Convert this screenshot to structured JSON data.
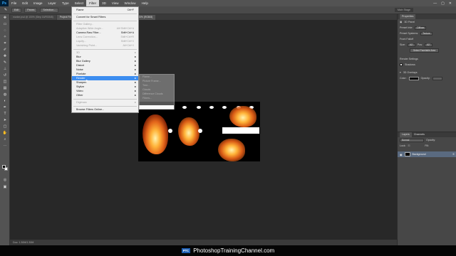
{
  "app": {
    "logo": "Ps"
  },
  "menubar": {
    "items": [
      "File",
      "Edit",
      "Image",
      "Layer",
      "Type",
      "Select",
      "Filter",
      "3D",
      "View",
      "Window",
      "Help"
    ],
    "window_controls": [
      "—",
      "▢",
      "✕"
    ]
  },
  "options": {
    "left_buttons": [
      "Edit",
      "Panes",
      "Selection..."
    ],
    "right_label": "Main Stage"
  },
  "tabs": [
    {
      "label": "marker.psd @ 100% (Step 16/RGB/8)",
      "active": false
    },
    {
      "label": "Project Files Adobe Photoshop CC 2014 Panels Light Default 06.psd @ 100% (RGB/8)",
      "active": true
    }
  ],
  "filter_menu": {
    "items": [
      {
        "label": "Flame",
        "shortcut": "Ctrl+F",
        "disabled": false,
        "submenu": false,
        "highlight": false
      },
      {
        "sep": true
      },
      {
        "label": "Convert for Smart Filters",
        "shortcut": "",
        "disabled": false,
        "submenu": false,
        "highlight": false
      },
      {
        "sep": true
      },
      {
        "label": "Filter Gallery...",
        "shortcut": "",
        "disabled": true,
        "submenu": false,
        "highlight": false
      },
      {
        "label": "Adaptive Wide Angle...",
        "shortcut": "Alt+Shift+Ctrl+A",
        "disabled": true,
        "submenu": false,
        "highlight": false
      },
      {
        "label": "Camera Raw Filter...",
        "shortcut": "Shift+Ctrl+A",
        "disabled": false,
        "submenu": false,
        "highlight": false
      },
      {
        "label": "Lens Correction...",
        "shortcut": "Shift+Ctrl+R",
        "disabled": true,
        "submenu": false,
        "highlight": false
      },
      {
        "label": "Liquify...",
        "shortcut": "Shift+Ctrl+X",
        "disabled": true,
        "submenu": false,
        "highlight": false
      },
      {
        "label": "Vanishing Point...",
        "shortcut": "Alt+Ctrl+V",
        "disabled": true,
        "submenu": false,
        "highlight": false
      },
      {
        "sep": true
      },
      {
        "label": "3D",
        "shortcut": "",
        "disabled": true,
        "submenu": true,
        "highlight": false
      },
      {
        "label": "Blur",
        "shortcut": "",
        "disabled": false,
        "submenu": true,
        "highlight": false
      },
      {
        "label": "Blur Gallery",
        "shortcut": "",
        "disabled": false,
        "submenu": true,
        "highlight": false
      },
      {
        "label": "Distort",
        "shortcut": "",
        "disabled": false,
        "submenu": true,
        "highlight": false
      },
      {
        "label": "Noise",
        "shortcut": "",
        "disabled": false,
        "submenu": true,
        "highlight": false
      },
      {
        "label": "Pixelate",
        "shortcut": "",
        "disabled": false,
        "submenu": true,
        "highlight": false
      },
      {
        "label": "Render",
        "shortcut": "",
        "disabled": false,
        "submenu": true,
        "highlight": true
      },
      {
        "label": "Sharpen",
        "shortcut": "",
        "disabled": false,
        "submenu": true,
        "highlight": false
      },
      {
        "label": "Stylize",
        "shortcut": "",
        "disabled": false,
        "submenu": true,
        "highlight": false
      },
      {
        "label": "Video",
        "shortcut": "",
        "disabled": false,
        "submenu": true,
        "highlight": false
      },
      {
        "label": "Other",
        "shortcut": "",
        "disabled": false,
        "submenu": true,
        "highlight": false
      },
      {
        "sep": true
      },
      {
        "label": "Digimarc",
        "shortcut": "",
        "disabled": true,
        "submenu": true,
        "highlight": false
      },
      {
        "sep": true
      },
      {
        "label": "Browse Filters Online...",
        "shortcut": "",
        "disabled": false,
        "submenu": false,
        "highlight": false
      }
    ]
  },
  "render_submenu": {
    "items": [
      "Flame...",
      "Picture Frame...",
      "Tree...",
      "Clouds",
      "Difference Clouds",
      "Fibers..."
    ]
  },
  "properties": {
    "tabs": [
      "Properties"
    ],
    "title": "3D Panel",
    "rows": [
      {
        "label": "Preset Inte:",
        "value": "Diffuse"
      },
      {
        "label": "Preset Systems:",
        "value": "Texture"
      }
    ],
    "section_label": "Front Falloff",
    "size_row": {
      "label": "Size:",
      "value": "90°",
      "label2": "Pos:",
      "value2": "90°"
    },
    "button_label": "Select Facetable Area",
    "render_settings": "Render Settings",
    "shadows_label": "Shadows",
    "overlays_label": "3D Overlays",
    "color_label": "Color:",
    "opacity_label": "Opacity:"
  },
  "layers": {
    "tabs": [
      "Layers",
      "Channels"
    ],
    "kind_label": "Normal",
    "opacity_label": "Opacity:",
    "lock_label": "Lock:",
    "fill_label": "Fill:",
    "layer_name": "Background"
  },
  "status": {
    "text": "Doc: 1.30M/1.30M"
  },
  "branding": {
    "logo": "PTC",
    "text": "PhotoshopTrainingChannel.com"
  },
  "colors": {
    "highlight": "#3c8df0",
    "panel": "#535353",
    "canvas_bg": "#282828"
  }
}
